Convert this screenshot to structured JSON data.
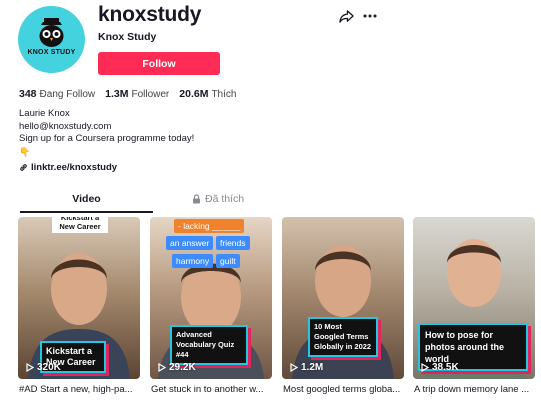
{
  "profile": {
    "username": "knoxstudy",
    "nickname": "Knox Study",
    "avatar_text": "KNOX STUDY",
    "follow_label": "Follow"
  },
  "stats": {
    "following_count": "348",
    "following_label": "Đang Follow",
    "followers_count": "1.3M",
    "followers_label": "Follower",
    "likes_count": "20.6M",
    "likes_label": "Thích"
  },
  "bio": {
    "line1": "Laurie Knox",
    "line2": "hello@knoxstudy.com",
    "line3": "Sign up for a Coursera programme today!",
    "line4": "👇"
  },
  "link": "linktr.ee/knoxstudy",
  "tabs": {
    "video": "Video",
    "liked": "Đã thích"
  },
  "videos": [
    {
      "views": "320K",
      "caption": "#AD Start a new, high-pa...",
      "overlay_top": "Kickstart a New Career",
      "overlay_main": "Kickstart a New Career"
    },
    {
      "views": "29.2K",
      "caption": "Get stuck in to another w...",
      "overlay_main": "Advanced Vocabulary Quiz #44",
      "chips": [
        "- lacking ______",
        "an answer",
        "friends",
        "harmony",
        "guilt"
      ]
    },
    {
      "views": "1.2M",
      "caption": "Most googled terms globa...",
      "overlay_main": "10 Most Googled Terms Globally in 2022"
    },
    {
      "views": "38.5K",
      "caption": "A trip down memory lane ...",
      "overlay_main": "How to pose for photos around the world"
    }
  ],
  "colors": {
    "follow_button": "#fe2c55",
    "avatar_bg": "#44d3de",
    "overlay_border": "#26c6e0",
    "overlay_shadow": "#e0245e"
  }
}
